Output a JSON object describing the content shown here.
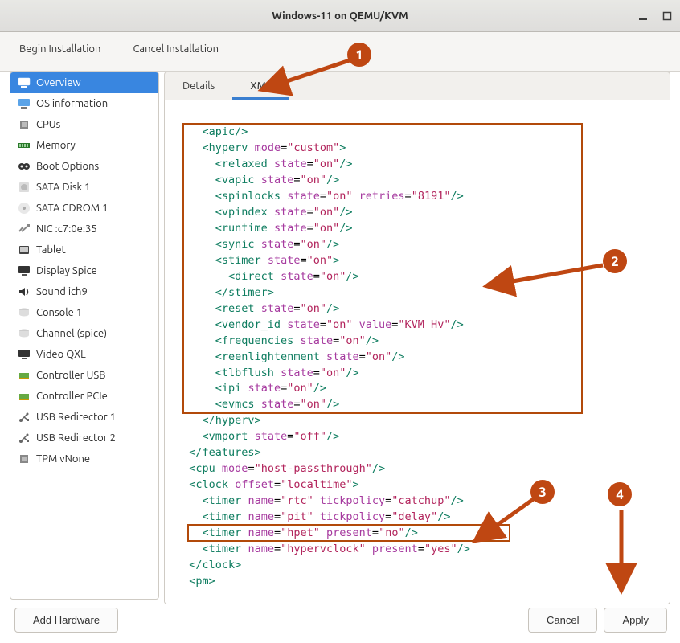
{
  "window": {
    "title": "Windows-11 on QEMU/KVM",
    "begin_label": "Begin Installation",
    "cancel_install_label": "Cancel Installation"
  },
  "sidebar": {
    "items": [
      {
        "label": "Overview"
      },
      {
        "label": "OS information"
      },
      {
        "label": "CPUs"
      },
      {
        "label": "Memory"
      },
      {
        "label": "Boot Options"
      },
      {
        "label": "SATA Disk 1"
      },
      {
        "label": "SATA CDROM 1"
      },
      {
        "label": "NIC :c7:0e:35"
      },
      {
        "label": "Tablet"
      },
      {
        "label": "Display Spice"
      },
      {
        "label": "Sound ich9"
      },
      {
        "label": "Console 1"
      },
      {
        "label": "Channel (spice)"
      },
      {
        "label": "Video QXL"
      },
      {
        "label": "Controller USB"
      },
      {
        "label": "Controller PCIe"
      },
      {
        "label": "USB Redirector 1"
      },
      {
        "label": "USB Redirector 2"
      },
      {
        "label": "TPM vNone"
      }
    ]
  },
  "tabs": {
    "details_label": "Details",
    "xml_label": "XML"
  },
  "buttons": {
    "add_hw": "Add Hardware",
    "cancel": "Cancel",
    "apply": "Apply"
  },
  "callouts": {
    "c1": "1",
    "c2": "2",
    "c3": "3",
    "c4": "4"
  },
  "xml": {
    "apic": "apic",
    "hyperv": "hyperv",
    "mode_attr": "mode",
    "mode_v": "custom",
    "relaxed": "relaxed",
    "state_attr": "state",
    "on": "on",
    "vapic": "vapic",
    "spinlocks": "spinlocks",
    "retries_attr": "retries",
    "retries_v": "8191",
    "vpindex": "vpindex",
    "runtime": "runtime",
    "synic": "synic",
    "stimer": "stimer",
    "direct": "direct",
    "reset": "reset",
    "vendor_id": "vendor_id",
    "value_attr": "value",
    "vendor_v": "KVM Hv",
    "frequencies": "frequencies",
    "reenlighten": "reenlightenment",
    "tlbflush": "tlbflush",
    "ipi": "ipi",
    "evmcs": "evmcs",
    "vmport": "vmport",
    "off": "off",
    "features": "features",
    "cpu": "cpu",
    "cpu_mode_v": "host-passthrough",
    "clock": "clock",
    "offset_attr": "offset",
    "offset_v": "localtime",
    "timer": "timer",
    "name_attr": "name",
    "rtc": "rtc",
    "pit": "pit",
    "hpet": "hpet",
    "hypervclock": "hypervclock",
    "tickpolicy_attr": "tickpolicy",
    "catchup": "catchup",
    "delay": "delay",
    "present_attr": "present",
    "no": "no",
    "yes": "yes",
    "pm": "pm"
  }
}
